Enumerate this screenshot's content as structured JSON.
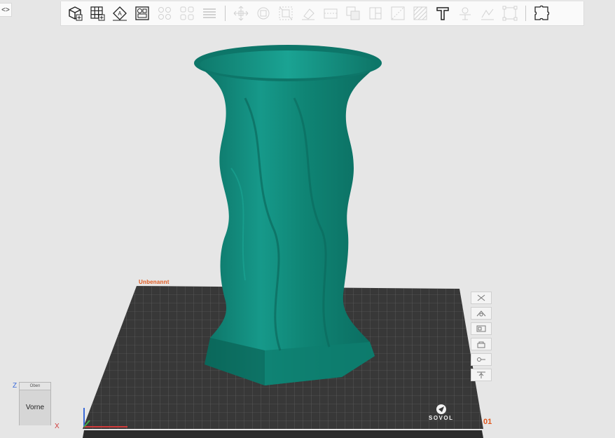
{
  "app": {
    "collapse_toggle": "<>"
  },
  "toolbar": {
    "groups": [
      [
        "add-cube-icon",
        "grid-add-icon",
        "auto-orient-icon",
        "arrange-icon"
      ],
      [
        "multi-plate-icon",
        "split-objects-icon",
        "layers-icon"
      ],
      [
        "move-icon",
        "rotate-icon",
        "scale-icon",
        "lay-on-face-icon",
        "cut-icon",
        "boolean-icon",
        "support-paint-icon",
        "seam-paint-icon",
        "fuzzy-skin-icon",
        "text-icon",
        "measure-icon",
        "emboss-icon",
        "assembly-icon"
      ],
      [
        "puzzle-icon"
      ]
    ]
  },
  "plate": {
    "label": "Unbenannt",
    "number": "01",
    "brand": "SOVOL"
  },
  "plate_tools": [
    "remove-plate-icon",
    "orient-plate-icon",
    "arrange-plate-icon",
    "lock-plate-icon",
    "plate-settings-icon",
    "move-plate-icon"
  ],
  "view_cube": {
    "top": "Oben",
    "front": "Vorne"
  },
  "axes": {
    "z": "Z",
    "x": "X"
  },
  "colors": {
    "model": "#0f8c7b",
    "plate": "#3a3a3a",
    "accent": "#e0581e"
  }
}
